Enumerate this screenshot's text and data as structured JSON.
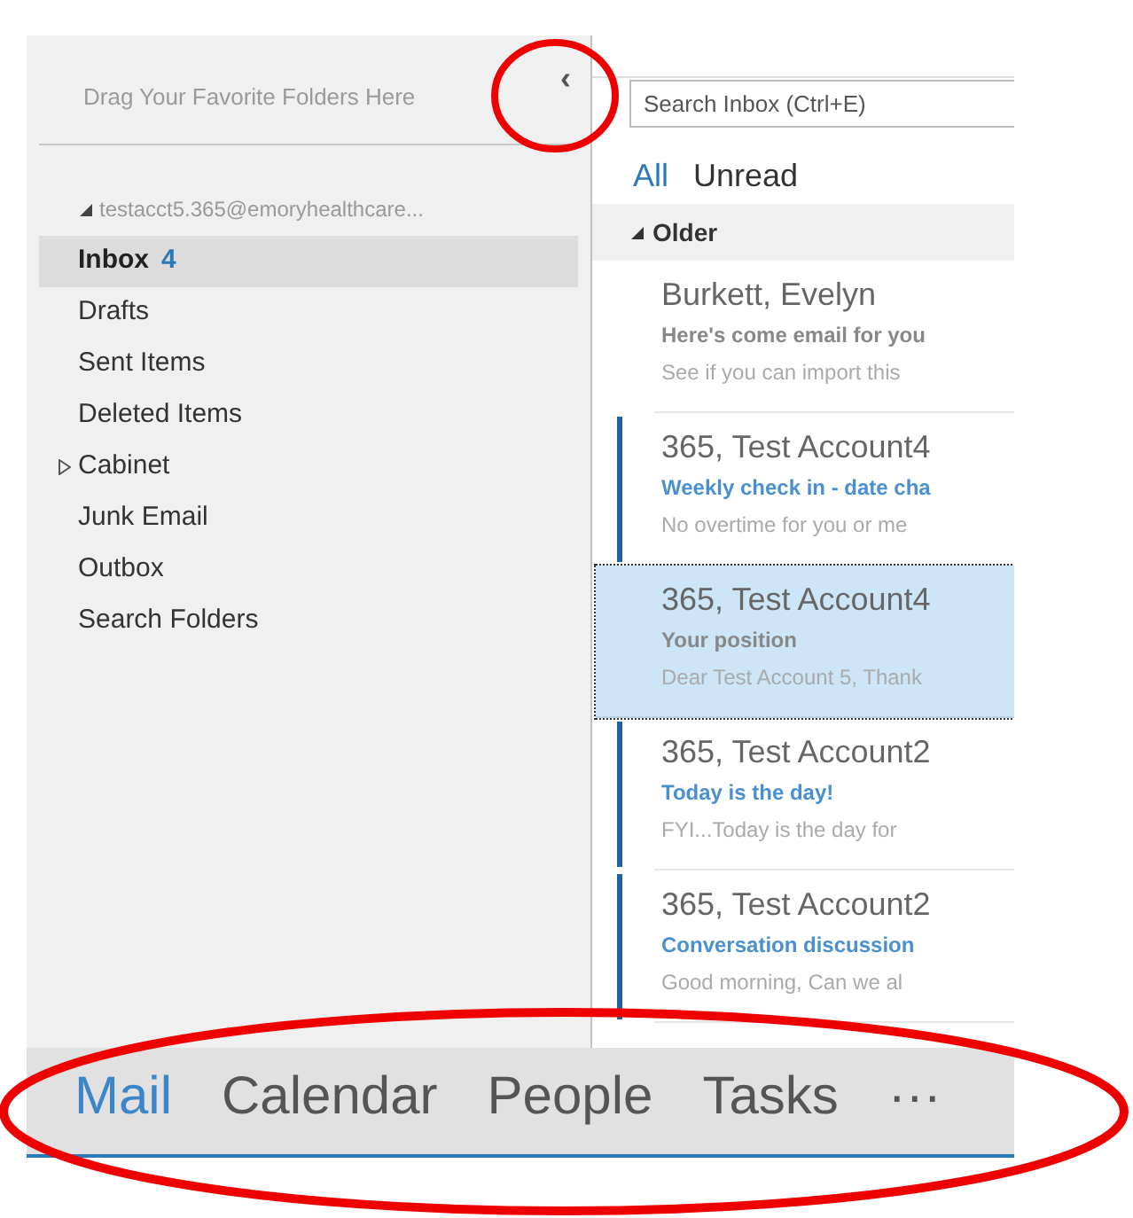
{
  "favorites": {
    "hint": "Drag Your Favorite Folders Here",
    "collapse_glyph": "‹"
  },
  "account": {
    "name": "testacct5.365@emoryhealthcare...",
    "expanded": true
  },
  "folders": [
    {
      "label": "Inbox",
      "count": "4",
      "selected": true
    },
    {
      "label": "Drafts",
      "selected": false
    },
    {
      "label": "Sent Items",
      "selected": false
    },
    {
      "label": "Deleted Items",
      "selected": false
    },
    {
      "label": "Cabinet",
      "selected": false,
      "expanded": false
    },
    {
      "label": "Junk Email",
      "selected": false
    },
    {
      "label": "Outbox",
      "selected": false
    },
    {
      "label": "Search Folders",
      "selected": false
    }
  ],
  "search": {
    "placeholder": "Search Inbox (Ctrl+E)"
  },
  "filters": [
    {
      "label": "All",
      "selected": true
    },
    {
      "label": "Unread",
      "selected": false
    }
  ],
  "group": {
    "label": "Older",
    "expanded": true
  },
  "messages": [
    {
      "sender": "Burkett, Evelyn",
      "subject": "Here's come email for you",
      "preview": "See if you can import this",
      "unread": false,
      "selected": false
    },
    {
      "sender": "365, Test Account4",
      "subject": "Weekly check in - date cha",
      "preview": "No overtime for you or me",
      "unread": true,
      "selected": false
    },
    {
      "sender": "365, Test Account4",
      "subject": "Your position",
      "preview": "Dear Test Account 5,  Thank",
      "unread": false,
      "selected": true
    },
    {
      "sender": "365, Test Account2",
      "subject": "Today is the day!",
      "preview": "FYI...Today is the day for",
      "unread": true,
      "selected": false
    },
    {
      "sender": "365, Test Account2",
      "subject": "Conversation discussion",
      "preview": "Good morning,  Can we al",
      "unread": true,
      "selected": false
    }
  ],
  "nav": [
    {
      "label": "Mail",
      "selected": true
    },
    {
      "label": "Calendar",
      "selected": false
    },
    {
      "label": "People",
      "selected": false
    },
    {
      "label": "Tasks",
      "selected": false
    },
    {
      "label": "···",
      "selected": false
    }
  ]
}
